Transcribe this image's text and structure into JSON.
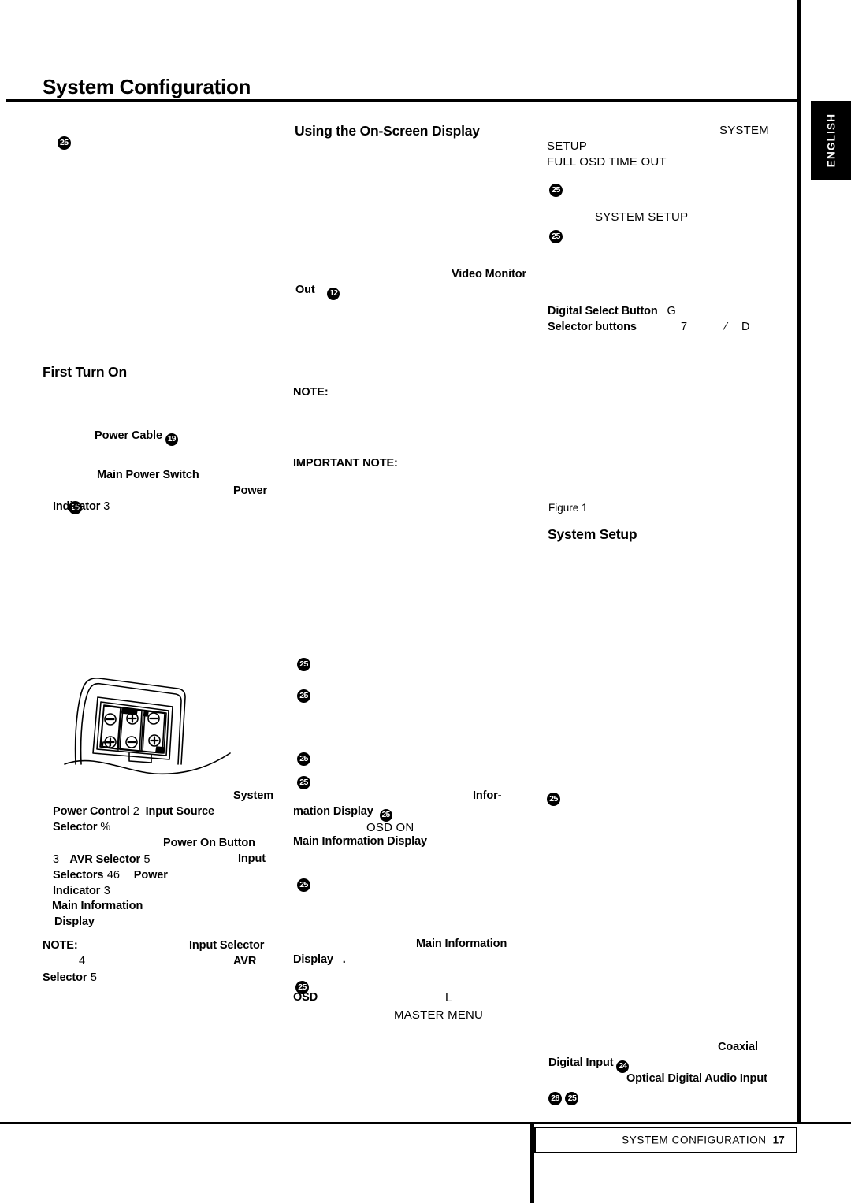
{
  "page": {
    "title": "System Configuration",
    "side_tab": "ENGLISH",
    "footer": {
      "section": "SYSTEM CONFIGURATION",
      "page_number": "17"
    }
  },
  "columns": {
    "left": {
      "ref_top": "25",
      "heading_first_turn_on": "First Turn On",
      "power_cable_label": "Power Cable",
      "power_cable_ref": "19",
      "main_power_switch_label": "Main Power Switch",
      "ref_main_power": "25",
      "power_word": "Power",
      "indicator_label": "Indicator",
      "indicator_num": "3",
      "system_word": "System",
      "power_control_label": "Power Control",
      "power_control_num": "2",
      "input_source_label": "Input Source",
      "selector_label": "Selector",
      "selector_symbol": "%",
      "power_on_button_label": "Power On Button",
      "num_3": "3",
      "avr_selector_label": "AVR Selector",
      "avr_selector_num": "5",
      "input_word": "Input",
      "selectors_label": "Selectors",
      "selectors_nums": "46",
      "power_word2": "Power",
      "indicator_label2": "Indicator",
      "indicator_num2": "3",
      "main_information_label": "Main Information",
      "display_label": "Display",
      "note_label": "NOTE:",
      "input_selector_label": "Input Selector",
      "num_4": "4",
      "avr_word": "AVR",
      "selector_label2": "Selector",
      "selector_num2": "5"
    },
    "middle": {
      "heading_osd": "Using the On-Screen Display",
      "video_monitor_label": "Video Monitor",
      "out_label": "Out",
      "out_ref": "12",
      "note_label": "NOTE:",
      "important_note_label": "IMPORTANT NOTE:",
      "ref_a": "25",
      "ref_b": "25",
      "ref_c": "25",
      "ref_d": "25",
      "information_hyphen": "Infor-",
      "mation_display_label": "mation Display",
      "ref_e": "25",
      "osd_on_text": "OSD ON",
      "main_information_display_label": "Main Information Display",
      "ref_f": "25",
      "main_information_label2": "Main Information",
      "display_label2": "Display",
      "display_period": ".",
      "ref_g": "25",
      "osd_label": "OSD",
      "letter_l": "L",
      "master_menu_text": "MASTER MENU"
    },
    "right": {
      "system_word": "SYSTEM",
      "setup_word": "SETUP",
      "full_osd_time_out": "FULL OSD TIME OUT",
      "ref_a": "25",
      "system_setup_text": "SYSTEM SETUP",
      "ref_b": "25",
      "digital_select_button_label": "Digital Select Button",
      "digital_select_key": "G",
      "selector_buttons_label": "Selector buttons",
      "selector_key_7": "7",
      "selector_slash": "⁄",
      "selector_key_d": "D",
      "figure_caption": "Figure 1",
      "heading_system_setup": "System Setup",
      "ref_c": "25",
      "coaxial_label": "Coaxial",
      "digital_input_label": "Digital Input",
      "digital_input_ref": "24",
      "optical_digital_audio_input_label": "Optical Digital Audio Input",
      "ref_28": "28",
      "ref_25": "25"
    }
  },
  "figure": {
    "name": "remote-battery-compartment",
    "battery_count": "3",
    "battery_type": "AA"
  },
  "colors": {
    "ink": "#000000",
    "paper": "#ffffff"
  }
}
